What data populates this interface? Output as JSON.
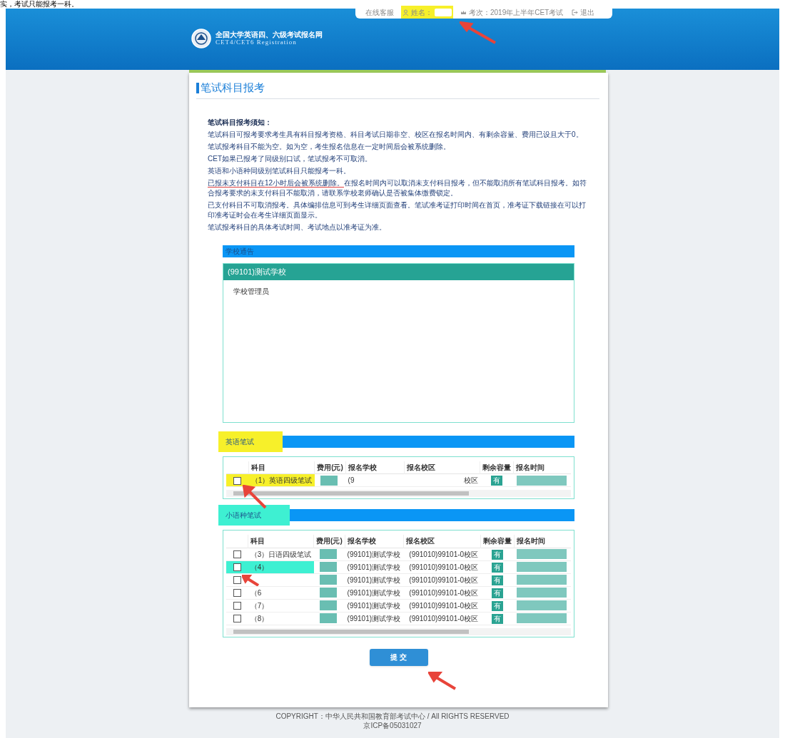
{
  "caption_fragment": "实，考试只能报考一科。",
  "top_bar": {
    "items": [
      {
        "kind": "link",
        "text": "在线客服",
        "highlighted": false
      },
      {
        "kind": "name",
        "text": "姓名：",
        "highlighted": true
      },
      {
        "kind": "session",
        "text": "考次：2019年上半年CET考试",
        "highlighted": false
      },
      {
        "kind": "logout",
        "text": "退出",
        "highlighted": false
      }
    ]
  },
  "logo": {
    "title": "全国大学英语四、六级考试报名网",
    "subtitle": "CET4/CET6  Registration"
  },
  "page_title": "笔试科目报考",
  "notice": {
    "heading": "笔试科目报考须知：",
    "paragraphs": [
      {
        "kind": "plain",
        "text": "笔试科目可报考要求考生具有科目报考资格、科目考试日期非空、校区在报名时间内、有剩余容量、费用已设且大于0。"
      },
      {
        "kind": "plain",
        "text": "笔试报考科目不能为空。如为空，考生报名信息在一定时间后会被系统删除。"
      },
      {
        "kind": "plain",
        "text": "CET如果已报考了同级别口试，笔试报考不可取消。"
      },
      {
        "kind": "plain",
        "text": "英语和小语种同级别笔试科目只能报考一科。"
      },
      {
        "kind": "marked",
        "marked": "已报未支付科目在12小时后会被系统删除。",
        "text": "在报名时间内可以取消未支付科目报考，但不能取消所有笔试科目报考。如符合报考要求的未支付科目不能取消，请联系学校老师确认是否被集体缴费锁定。"
      },
      {
        "kind": "plain",
        "text": "已支付科目不可取消报考。具体编排信息可到考生详细页面查看。笔试准考证打印时间在首页，准考证下载链接在可以打印准考证时会在考生详细页面显示。"
      },
      {
        "kind": "plain",
        "text": "笔试报考科目的具体考试时间、考试地点以准考证为准。"
      }
    ]
  },
  "school_notice": {
    "title": "学校通告",
    "school": "(99101)测试学校",
    "body": "学校管理员"
  },
  "sections": [
    {
      "title": "英语笔试",
      "color": "#f7f02a",
      "columns": [
        "科目",
        "费用(元)",
        "报名学校",
        "报名校区",
        "剩余容量",
        "报名时间"
      ],
      "rows": [
        {
          "checked": false,
          "color": "#f7f02a",
          "subject": "（1）英语四级笔试",
          "school": "(9",
          "campus": "校区",
          "capacity": "有"
        }
      ]
    },
    {
      "title": "小语种笔试",
      "color": "#3ef0d2",
      "columns": [
        "科目",
        "费用(元)",
        "报名学校",
        "报名校区",
        "剩余容量",
        "报名时间"
      ],
      "rows": [
        {
          "checked": false,
          "subject": "（3）日语四级笔试",
          "school": "(99101)测试学校",
          "campus": "(991010)99101-0校区",
          "capacity": "有"
        },
        {
          "checked": false,
          "color": "#3ef0d2",
          "subject": "（4）",
          "school": "(99101)测试学校",
          "campus": "(991010)99101-0校区",
          "capacity": "有"
        },
        {
          "checked": false,
          "school": "(99101)测试学校",
          "campus": "(991010)99101-0校区",
          "capacity": "有"
        },
        {
          "checked": false,
          "subject": "（6",
          "school": "(99101)测试学校",
          "campus": "(991010)99101-0校区",
          "capacity": "有"
        },
        {
          "checked": false,
          "subject": "（7）",
          "school": "(99101)测试学校",
          "campus": "(991010)99101-0校区",
          "capacity": "有"
        },
        {
          "checked": false,
          "subject": "（8）",
          "school": "(99101)测试学校",
          "campus": "(991010)99101-0校区",
          "capacity": "有"
        }
      ]
    }
  ],
  "submit_button": "提 交",
  "footer": [
    "COPYRIGHT：中华人民共和国教育部考试中心 / All RIGHTS RESERVED",
    "京ICP备05031027"
  ]
}
